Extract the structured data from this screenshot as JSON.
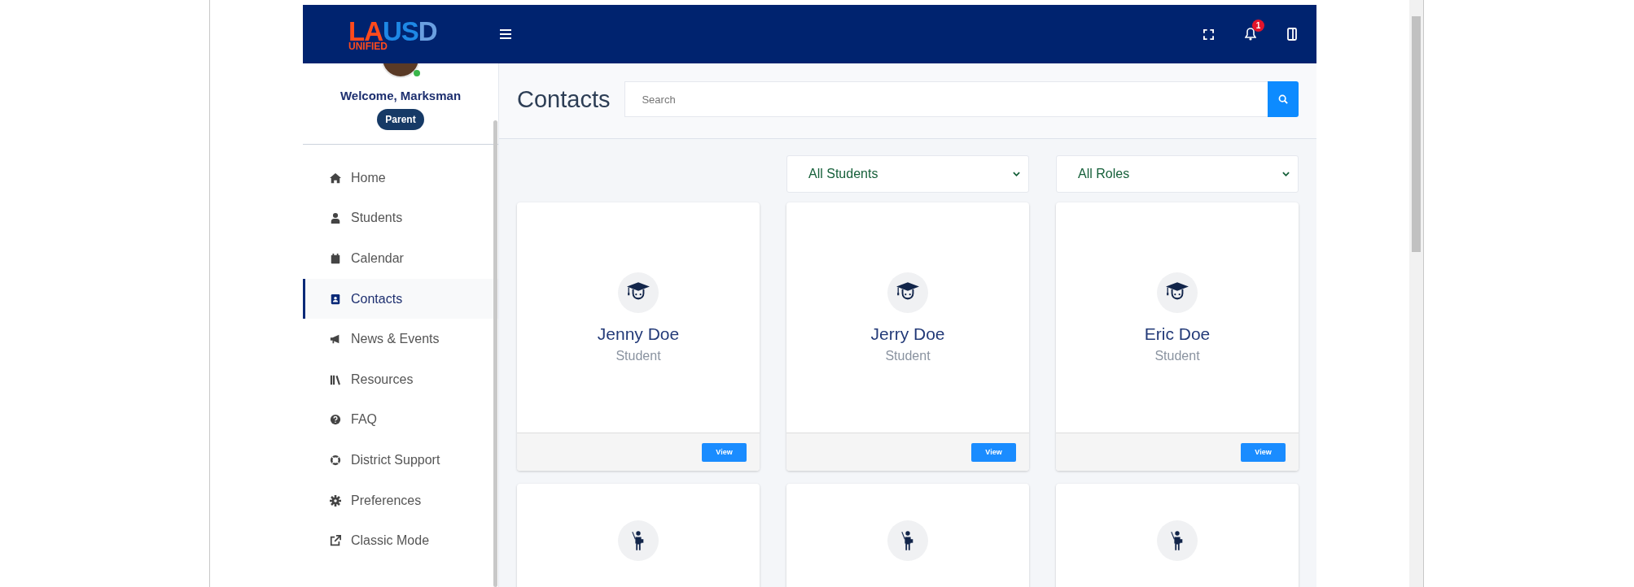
{
  "logo": {
    "segments": [
      "LA",
      "US",
      "D"
    ],
    "sub": "UNIFIED"
  },
  "header": {
    "notification_count": "1"
  },
  "user": {
    "welcome": "Welcome, Marksman",
    "role": "Parent",
    "online": true
  },
  "nav": [
    {
      "label": "Home",
      "selected": false
    },
    {
      "label": "Students",
      "selected": false
    },
    {
      "label": "Calendar",
      "selected": false
    },
    {
      "label": "Contacts",
      "selected": true
    },
    {
      "label": "News & Events",
      "selected": false
    },
    {
      "label": "Resources",
      "selected": false
    },
    {
      "label": "FAQ",
      "selected": false
    },
    {
      "label": "District Support",
      "selected": false
    },
    {
      "label": "Preferences",
      "selected": false
    },
    {
      "label": "Classic Mode",
      "selected": false
    }
  ],
  "page": {
    "title": "Contacts",
    "search": {
      "placeholder": "Search"
    }
  },
  "filters": [
    {
      "value": "All Students"
    },
    {
      "value": "All Roles"
    }
  ],
  "contacts": [
    {
      "kind": "student",
      "name": "Jenny Doe",
      "role": "Student",
      "action": "View"
    },
    {
      "kind": "student",
      "name": "Jerry Doe",
      "role": "Student",
      "action": "View"
    },
    {
      "kind": "student",
      "name": "Eric Doe",
      "role": "Student",
      "action": "View"
    },
    {
      "kind": "teacher"
    },
    {
      "kind": "teacher"
    },
    {
      "kind": "teacher"
    }
  ]
}
